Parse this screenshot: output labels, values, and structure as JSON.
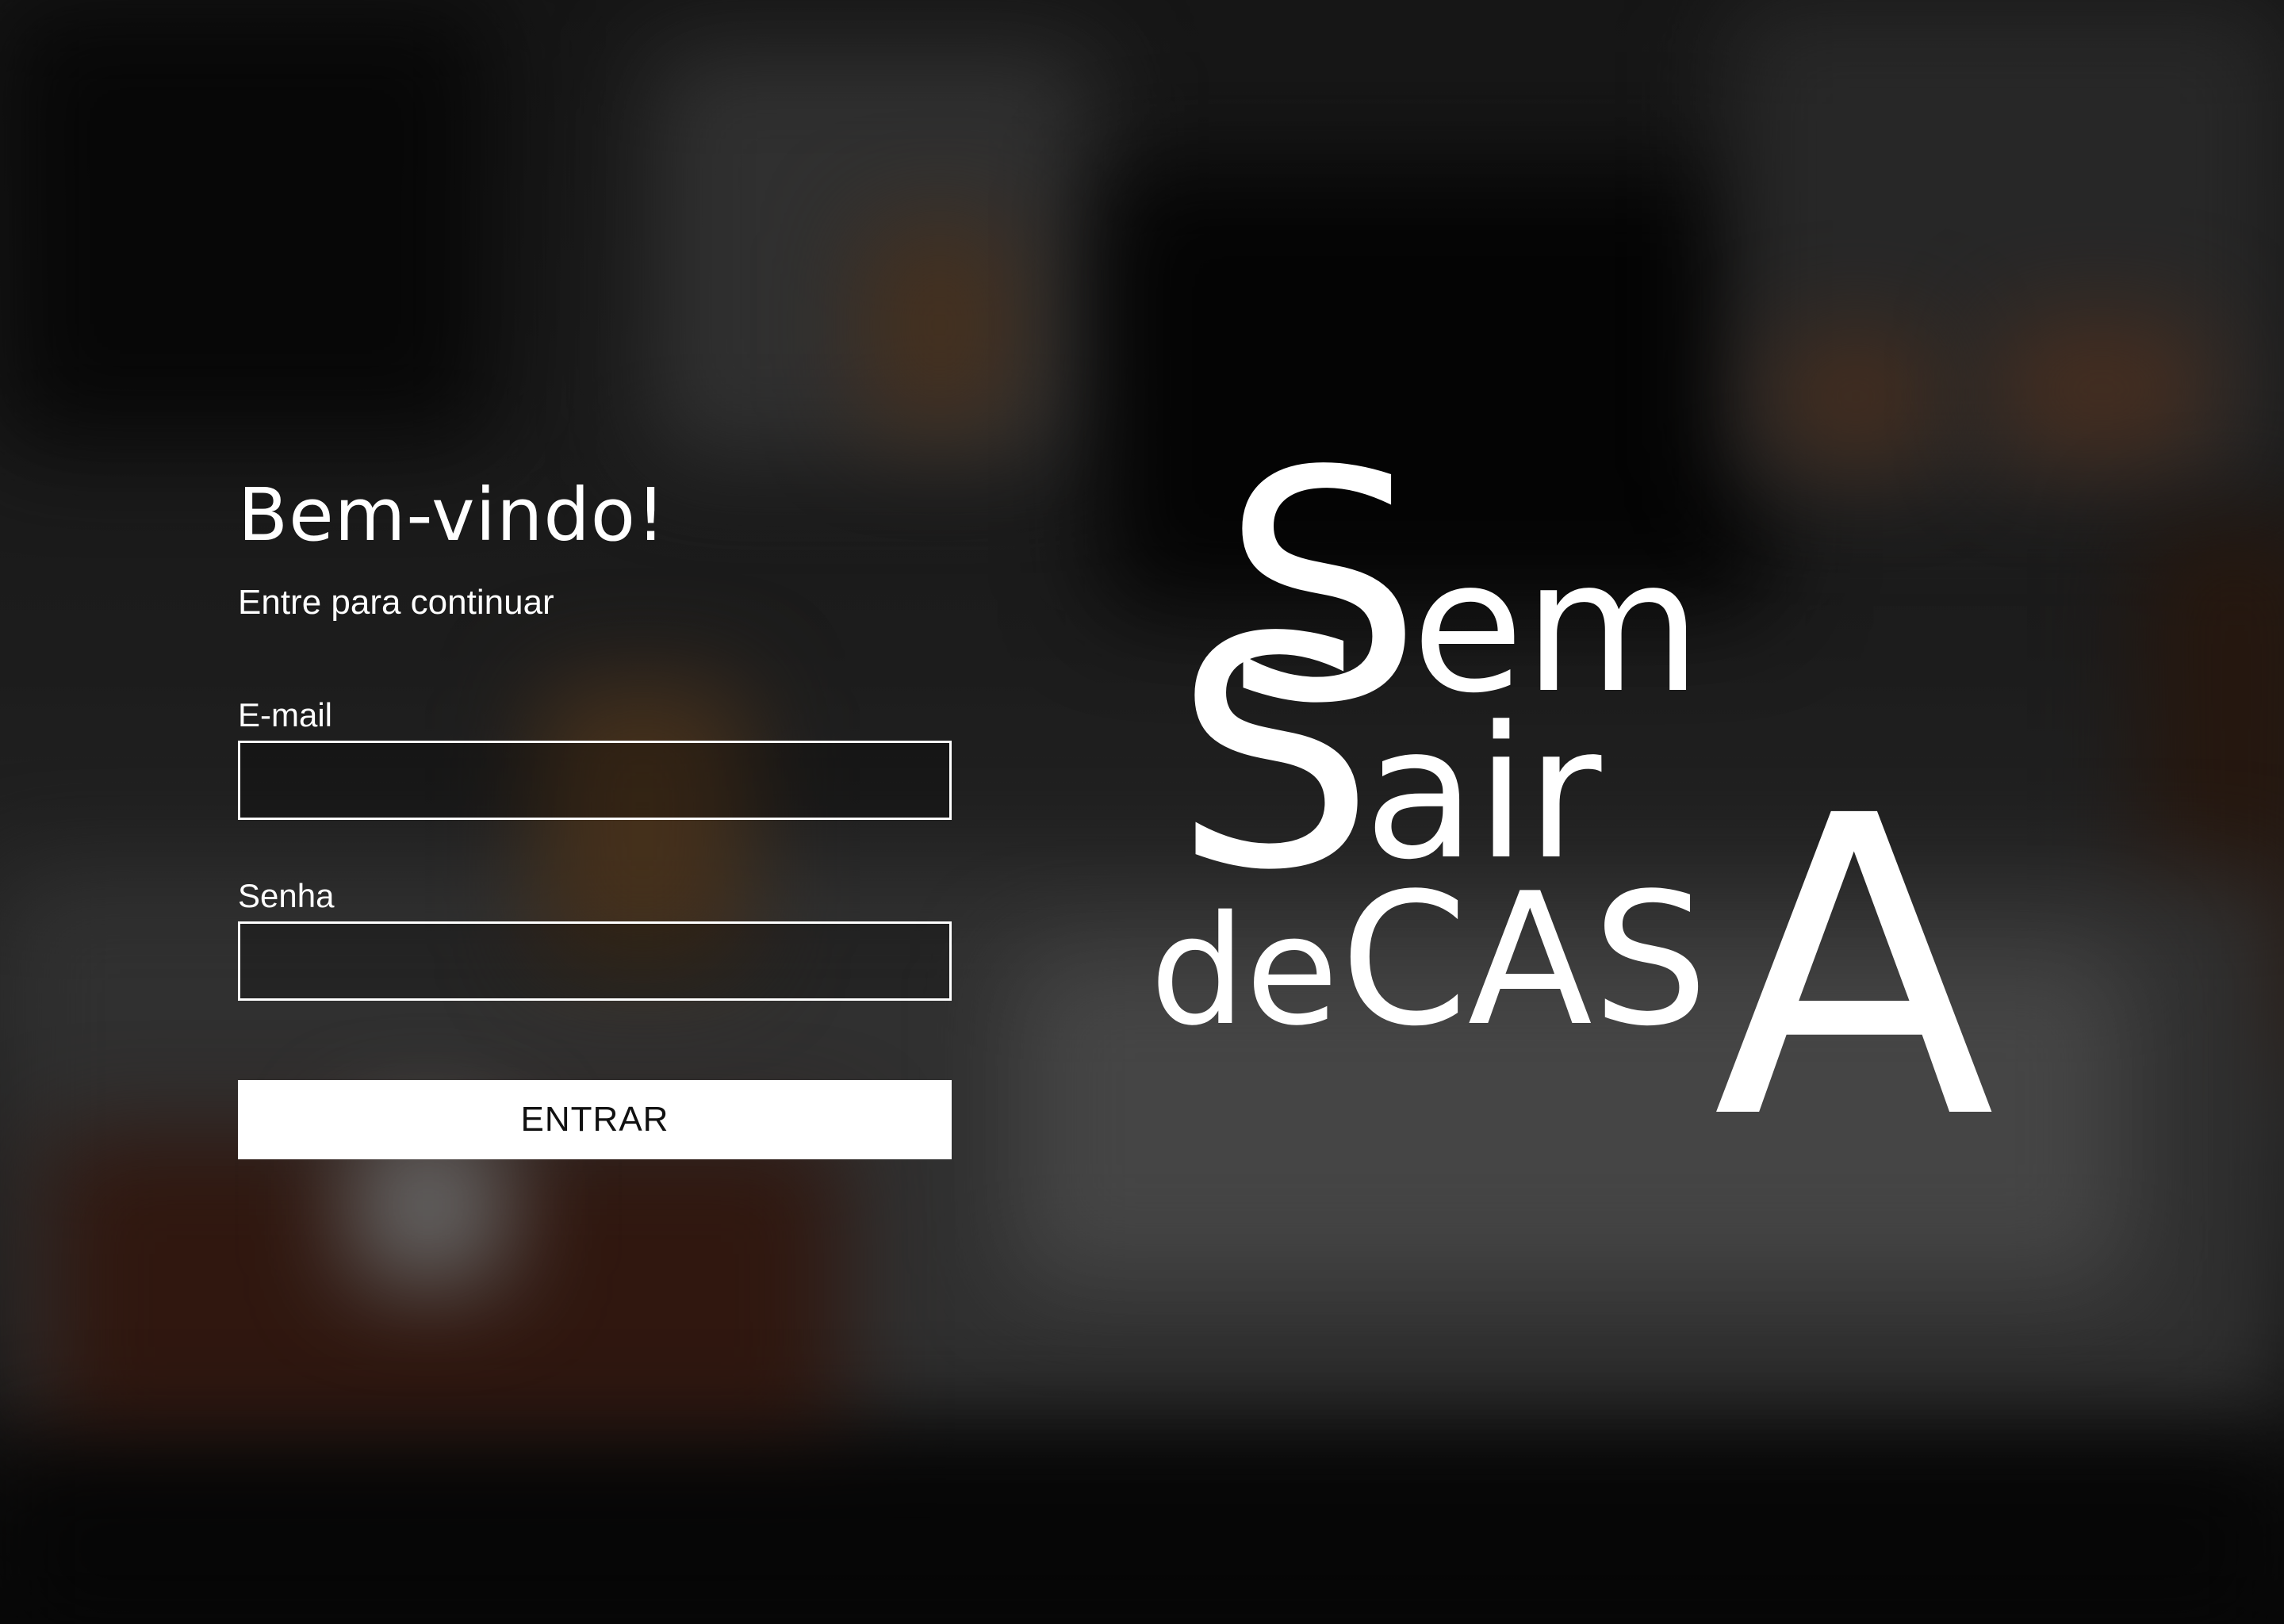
{
  "login": {
    "title": "Bem-vindo!",
    "subtitle": "Entre para continuar",
    "email_label": "E-mail",
    "email_value": "",
    "password_label": "Senha",
    "password_value": "",
    "submit_label": "ENTRAR"
  },
  "logo": {
    "line1_initial": "S",
    "line1_rest": "em",
    "line2_initial": "S",
    "line2_rest": "air",
    "line3_prefix": "de",
    "line3_main": "CAS",
    "line3_final": "A"
  },
  "colors": {
    "text": "#ffffff",
    "button_bg": "#ffffff",
    "button_text": "#111111"
  }
}
